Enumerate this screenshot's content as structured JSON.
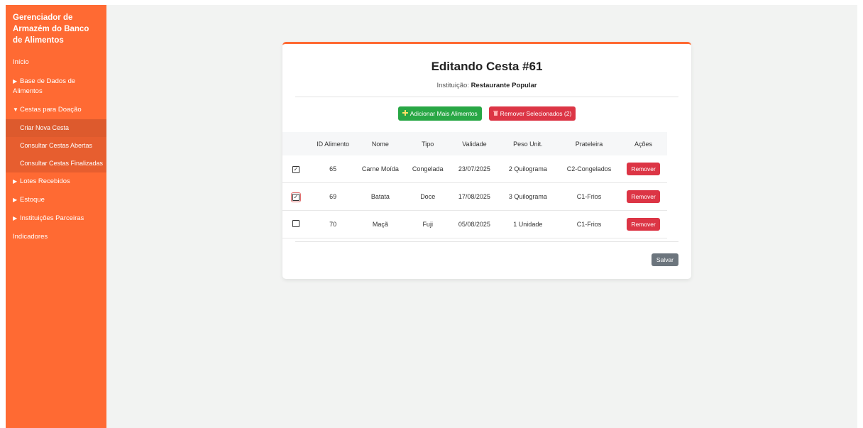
{
  "sidebar": {
    "brand": "Gerenciador de Armazém do Banco de Alimentos",
    "items": {
      "inicio": "Início",
      "base": "Base de Dados de Alimentos",
      "cestas": "Cestas para Doação",
      "lotes": "Lotes Recebidos",
      "estoque": "Estoque",
      "instituicoes": "Instituições Parceiras",
      "indicadores": "Indicadores"
    },
    "sub_items": {
      "criar": "Criar Nova Cesta",
      "abertas": "Consultar Cestas Abertas",
      "finalizadas": "Consultar Cestas Finalizadas"
    },
    "caret_collapsed": "▶",
    "caret_expanded": "▼"
  },
  "card": {
    "title": "Editando Cesta #61",
    "institution_label": "Instituição:",
    "institution_name": "Restaurante Popular",
    "add_button": "Adicionar Mais Alimentos",
    "remove_selected_button": "Remover Selecionados (2)",
    "save_button": "Salvar"
  },
  "table": {
    "headers": {
      "id": "ID Alimento",
      "nome": "Nome",
      "tipo": "Tipo",
      "validade": "Validade",
      "peso": "Peso Unit.",
      "prateleira": "Prateleira",
      "acoes": "Ações"
    },
    "rows": [
      {
        "checked": true,
        "id": "65",
        "nome": "Carne Moída",
        "tipo": "Congelada",
        "validade": "23/07/2025",
        "peso": "2 Quilograma",
        "prateleira": "C2-Congelados",
        "acao": "Remover"
      },
      {
        "checked": true,
        "id": "69",
        "nome": "Batata",
        "tipo": "Doce",
        "validade": "17/08/2025",
        "peso": "3 Quilograma",
        "prateleira": "C1-Frios",
        "acao": "Remover"
      },
      {
        "checked": false,
        "id": "70",
        "nome": "Maçã",
        "tipo": "Fuji",
        "validade": "05/08/2025",
        "peso": "1 Unidade",
        "prateleira": "C1-Frios",
        "acao": "Remover"
      }
    ]
  },
  "colors": {
    "accent": "#ff6a33",
    "success": "#28a745",
    "danger": "#dc3545",
    "secondary": "#6c757d"
  },
  "icons": {
    "add": "plus-icon",
    "remove_selected": "trash-icon"
  }
}
